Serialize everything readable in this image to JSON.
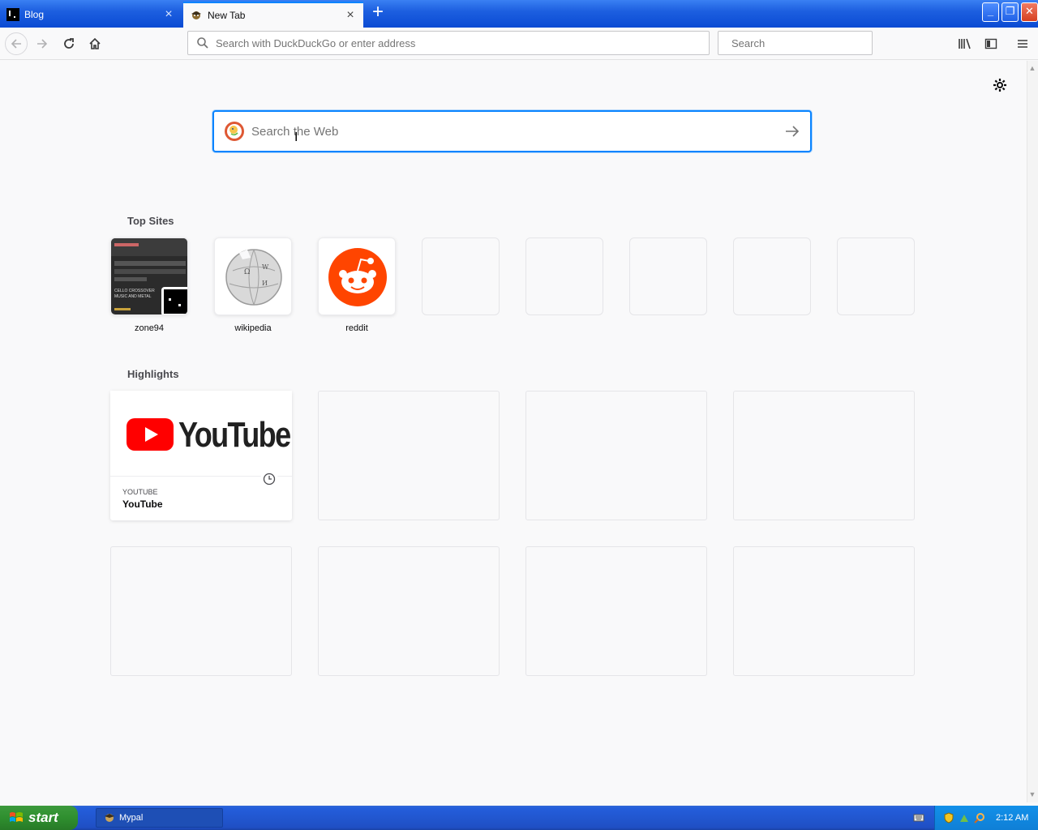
{
  "tabs": [
    {
      "label": "Blog",
      "favicon": "blog-favicon"
    },
    {
      "label": "New Tab",
      "favicon": "mypal-favicon"
    }
  ],
  "toolbar": {
    "url_placeholder": "Search with DuckDuckGo or enter address",
    "search_placeholder": "Search"
  },
  "newtab": {
    "search_placeholder": "Search the Web",
    "top_sites_title": "Top Sites",
    "top_sites": [
      {
        "label": "zone94",
        "thumb": "zone94-screenshot"
      },
      {
        "label": "wikipedia",
        "thumb": "wikipedia-globe-icon"
      },
      {
        "label": "reddit",
        "thumb": "reddit-alien-icon"
      },
      {
        "label": ""
      },
      {
        "label": ""
      },
      {
        "label": ""
      },
      {
        "label": ""
      },
      {
        "label": ""
      }
    ],
    "highlights_title": "Highlights",
    "highlights": [
      {
        "source": "YOUTUBE",
        "title": "YouTube",
        "logo_text": "YouTube",
        "icon": "clock-icon"
      }
    ]
  },
  "zone94_thumb": {
    "headline": "CELLO CROSSOVER MUSIC AND METAL"
  },
  "taskbar": {
    "start_label": "start",
    "window_label": "Mypal",
    "clock": "2:12 AM"
  },
  "colors": {
    "accent": "#0a84ff",
    "reddit": "#ff4500",
    "youtube": "#ff0000",
    "xp_blue": "#245edb",
    "xp_green": "#2f8f2f"
  }
}
